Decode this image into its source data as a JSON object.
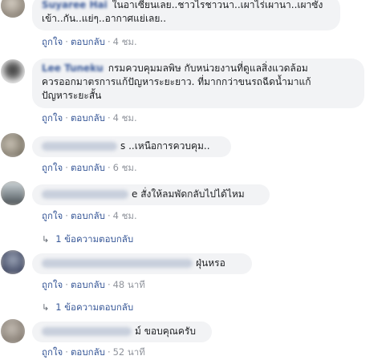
{
  "comments": [
    {
      "name": "Suyaree Hai",
      "text_lines": [
        "ในอาเซี่ยนเลย..ชาวไรชาวนา..เผาไร่เผานา..เผาซัง",
        "เข้า..กัน..แย่ๆ..อากาศแย่เลย.."
      ],
      "like": "ถูกใจ",
      "reply": "ตอบกลับ",
      "time": "4 ชม."
    },
    {
      "name": "Lee Tuneku",
      "text_lines": [
        "กรมควบคุมมลพิษ กับหน่วยงานที่ดูแลสิ่งแวดล้อม",
        "ควรออกมาตรการแก้ปัญหาระยะยาว. ที่มากกว่าขนรถฉีดน้ำมาแก้",
        "ปัญหาระยะสั้น"
      ],
      "like": "ถูกใจ",
      "reply": "ตอบกลับ",
      "time": "4 ชม."
    },
    {
      "name": "",
      "text_lines": [
        "s ..เหนือการควบคุม.."
      ],
      "like": "ถูกใจ",
      "reply": "ตอบกลับ",
      "time": "6 ชม."
    },
    {
      "name": "",
      "text_lines": [
        "e สั่งให้ลมพัดกลับไปได้ไหม"
      ],
      "like": "ถูกใจ",
      "reply": "ตอบกลับ",
      "time": "4 ชม.",
      "replies_link": "1 ข้อความตอบกลับ"
    },
    {
      "name": "",
      "text_lines": [
        "ฝุ่นหรอ"
      ],
      "like": "ถูกใจ",
      "reply": "ตอบกลับ",
      "time": "48 นาที",
      "replies_link": "1 ข้อความตอบกลับ"
    },
    {
      "name": "",
      "text_lines": [
        "ม์ ขอบคุณครับ"
      ],
      "like": "ถูกใจ",
      "reply": "ตอบกลับ",
      "time": "52 นาที"
    }
  ],
  "colors": {
    "link": "#385898",
    "bubble": "#f2f3f5",
    "muted": "#90949c"
  },
  "icons": {
    "reply_arrow": "reply-arrow-icon"
  }
}
